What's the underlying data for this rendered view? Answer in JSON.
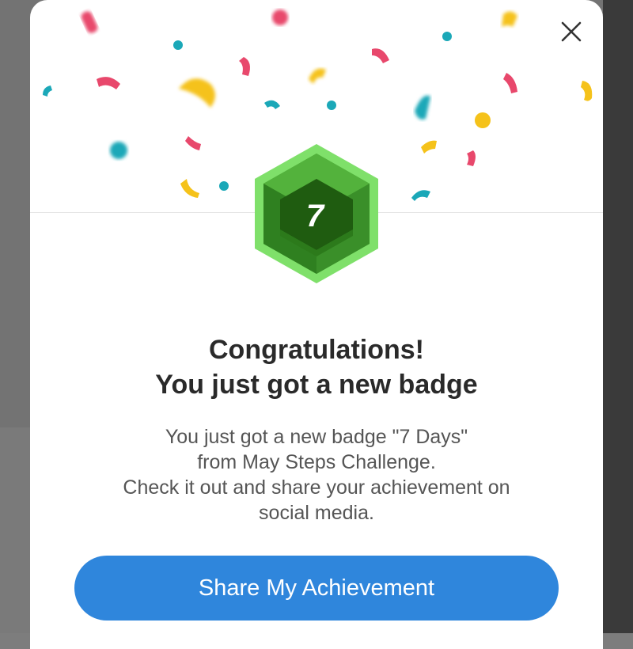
{
  "dialog": {
    "close_icon": "close-icon",
    "badge": {
      "icon": "hexagon-badge-icon",
      "number": "7",
      "colors": {
        "outer": "#7fe06a",
        "inner": "#3f9a2c",
        "dark": "#1f5c10"
      }
    },
    "title_line1": "Congratulations!",
    "title_line2": "You just got a new badge",
    "description": [
      "You just got a new badge \"7 Days\"",
      "from May Steps Challenge.",
      "Check it out and share your achievement on",
      "social media."
    ],
    "share_button_label": "Share My Achievement",
    "colors": {
      "accent": "#2f86dc",
      "title": "#2a2a2a",
      "body": "#555555"
    }
  },
  "confetti_colors": [
    "#e8486c",
    "#f5c21a",
    "#1ba8b8"
  ]
}
